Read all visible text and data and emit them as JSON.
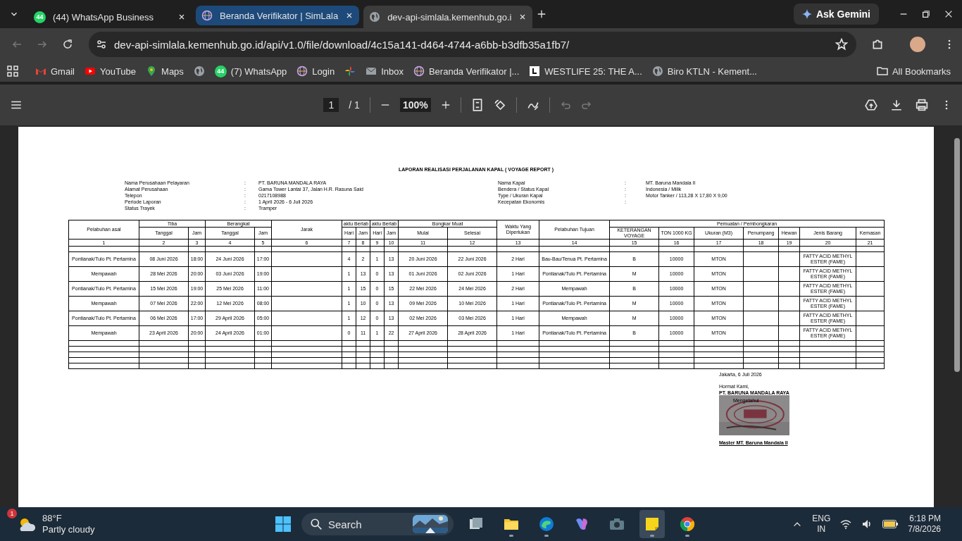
{
  "browser": {
    "tabs": [
      {
        "kind": "whatsapp",
        "title": "(44) WhatsApp Business",
        "badge": "44",
        "selected": false,
        "hovered": false
      },
      {
        "kind": "simlala",
        "title": "Beranda Verifikator | SimLala",
        "selected": false,
        "hovered": true
      },
      {
        "kind": "globe",
        "title": "dev-api-simlala.kemenhub.go.i",
        "selected": true,
        "hovered": false
      }
    ],
    "gemini_button": "Ask Gemini",
    "url": "dev-api-simlala.kemenhub.go.id/api/v1.0/file/download/4c15a141-d464-4744-a6bb-b3dfb35a1fb7/",
    "bookmarks": [
      {
        "kind": "gmail",
        "label": "Gmail"
      },
      {
        "kind": "youtube",
        "label": "YouTube"
      },
      {
        "kind": "maps",
        "label": "Maps"
      },
      {
        "kind": "globe"
      },
      {
        "kind": "whatsapp",
        "label": "(7) WhatsApp",
        "badge": "44"
      },
      {
        "kind": "simlala",
        "label": "Login"
      },
      {
        "kind": "pinwheel"
      },
      {
        "kind": "mail",
        "label": "Inbox"
      },
      {
        "kind": "simlala",
        "label": "Beranda Verifikator |..."
      },
      {
        "kind": "square",
        "label": "WESTLIFE 25: THE A..."
      },
      {
        "kind": "globe",
        "label": "Biro KTLN - Kement..."
      }
    ],
    "all_bookmarks": "All Bookmarks"
  },
  "pdf_toolbar": {
    "page": "1",
    "page_total": "/ 1",
    "zoom": "100%"
  },
  "report": {
    "title": "LAPORAN REALISASI PERJALANAN KAPAL ( VOYAGE REPORT )",
    "info_left": [
      {
        "label": "Nama Perusahaan Pelayaran",
        "sep": ":",
        "value": "PT. BARUNA MANDALA RAYA"
      },
      {
        "label": "Alamat Perusahaan",
        "sep": ":",
        "value": "Gama Tower Lantai 37, Jalan H.R. Rasuna Said"
      },
      {
        "label": "Telepon",
        "sep": ":",
        "value": "0217108988"
      },
      {
        "label": "Periode Laporan",
        "sep": ":",
        "value": "1 April 2026 - 6 Juli 2026"
      },
      {
        "label": "Status Trayek",
        "sep": ":",
        "value": "Tramper"
      }
    ],
    "info_right": [
      {
        "label": "Nama Kapal",
        "sep": ":",
        "value": "MT. Baruna Mandala II"
      },
      {
        "label": "Bendera / Status Kapal",
        "sep": ":",
        "value": "Indonesia / Milik"
      },
      {
        "label": "Type / Ukuran Kapal",
        "sep": ":",
        "value": "Motor Tanker / 113,28 X 17,80 X 9,00"
      },
      {
        "label": "Kecepatan Ekonomis",
        "sep": ":"
      }
    ],
    "header_groups": [
      {
        "label": "Pelabuhan asal"
      },
      {
        "label": "Tiba",
        "children": [
          "Tanggal",
          "Jam"
        ]
      },
      {
        "label": "Berangkat",
        "children": [
          "Tanggal",
          "Jam"
        ]
      },
      {
        "label": "Jarak"
      },
      {
        "label": "aktu Berlab",
        "children": [
          "Hari",
          "Jam"
        ]
      },
      {
        "label": "aktu Berlab",
        "children": [
          "Hari",
          "Jam"
        ]
      },
      {
        "label": "Bongkar Muat",
        "children": [
          "Mulai",
          "Selesai"
        ]
      },
      {
        "label": "Waktu Yang Diperlukan"
      },
      {
        "label": "Pelabuhan Tujuan"
      },
      {
        "label": "Pemuatan / Pembongkaran",
        "children": [
          "KETERANGAN VOYAGE",
          "TON 1000 KG",
          "Ukuran (M3)",
          "Penumpang",
          "Hewan",
          "Jenis Barang",
          "Kemasan"
        ]
      }
    ],
    "column_numbers": [
      "1",
      "2",
      "3",
      "4",
      "5",
      "6",
      "7",
      "8",
      "9",
      "10",
      "11",
      "12",
      "13",
      "14",
      "15",
      "16",
      "17",
      "18",
      "19",
      "20",
      "21"
    ],
    "rows": [
      {
        "1": "Pontianak/Tulo Pt. Pertamina",
        "2": "08 Juni 2026",
        "3": "18:00",
        "4": "24 Juni 2026",
        "5": "17:00",
        "7": "4",
        "8": "2",
        "9": "1",
        "10": "13",
        "11": "20 Juni 2026",
        "12": "22 Juni 2026",
        "13": "2 Hari",
        "14": "Bau-Bau/Tenua Pt. Pertamina",
        "15": "B",
        "16": "10000",
        "17": "MTON",
        "20": "FATTY ACID METHYL ESTER (FAME)"
      },
      {
        "1": "Mempawah",
        "2": "28 Mei 2026",
        "3": "20:00",
        "4": "03 Juni 2026",
        "5": "19:00",
        "7": "1",
        "8": "13",
        "9": "0",
        "10": "13",
        "11": "01 Juni 2026",
        "12": "02 Juni 2026",
        "13": "1 Hari",
        "14": "Pontianak/Tulo Pt. Pertamina",
        "15": "M",
        "16": "10000",
        "17": "MTON",
        "20": "FATTY ACID METHYL ESTER (FAME)"
      },
      {
        "1": "Pontianak/Tulo Pt. Pertamina",
        "2": "15 Mei 2026",
        "3": "19:00",
        "4": "25 Mei 2026",
        "5": "11:00",
        "7": "1",
        "8": "15",
        "9": "0",
        "10": "15",
        "11": "22 Mei 2026",
        "12": "24 Mei 2026",
        "13": "2 Hari",
        "14": "Mempawah",
        "15": "B",
        "16": "10000",
        "17": "MTON",
        "20": "FATTY ACID METHYL ESTER (FAME)"
      },
      {
        "1": "Mempawah",
        "2": "07 Mei 2026",
        "3": "22:00",
        "4": "12 Mei 2026",
        "5": "08:00",
        "7": "1",
        "8": "10",
        "9": "0",
        "10": "13",
        "11": "09 Mei 2026",
        "12": "10 Mei 2026",
        "13": "1 Hari",
        "14": "Pontianak/Tulo Pt. Pertamina",
        "15": "M",
        "16": "10000",
        "17": "MTON",
        "20": "FATTY ACID METHYL ESTER (FAME)"
      },
      {
        "1": "Pontianak/Tulo Pt. Pertamina",
        "2": "06 Mei 2026",
        "3": "17:00",
        "4": "29 April 2026",
        "5": "05:00",
        "7": "1",
        "8": "12",
        "9": "0",
        "10": "13",
        "11": "02 Mei 2026",
        "12": "03 Mei 2026",
        "13": "1 Hari",
        "14": "Mempawah",
        "15": "M",
        "16": "10000",
        "17": "MTON",
        "20": "FATTY ACID METHYL ESTER (FAME)"
      },
      {
        "1": "Mempawah",
        "2": "23 April 2026",
        "3": "20:00",
        "4": "24 April 2026",
        "5": "01:00",
        "7": "0",
        "8": "11",
        "9": "1",
        "10": "22",
        "11": "27 April 2026",
        "12": "28 April 2026",
        "13": "1 Hari",
        "14": "Pontianak/Tulo Pt. Pertamina",
        "15": "B",
        "16": "10000",
        "17": "MTON",
        "20": "FATTY ACID METHYL ESTER (FAME)"
      }
    ],
    "signature": {
      "place_date": "Jakarta, 6 Juli 2026",
      "greeting": "Hormat Kami,",
      "company": "PT. BARUNA MANDALA RAYA",
      "acknowledged": "Mengetahui",
      "signer": "Master MT. Baruna Mandala II"
    }
  },
  "taskbar": {
    "weather": {
      "temp": "88°F",
      "condition": "Partly cloudy",
      "badge": "1"
    },
    "search": "Search",
    "apps": [
      {
        "kind": "taskview",
        "running": false
      },
      {
        "kind": "folder",
        "running": true
      },
      {
        "kind": "edge",
        "running": true
      },
      {
        "kind": "copilot",
        "running": false
      },
      {
        "kind": "camera",
        "running": false
      },
      {
        "kind": "notes",
        "running": true
      },
      {
        "kind": "chrome",
        "running": true
      }
    ],
    "language": "ENG",
    "region": "IN",
    "time": "6:18 PM",
    "date": "7/8/2026"
  }
}
